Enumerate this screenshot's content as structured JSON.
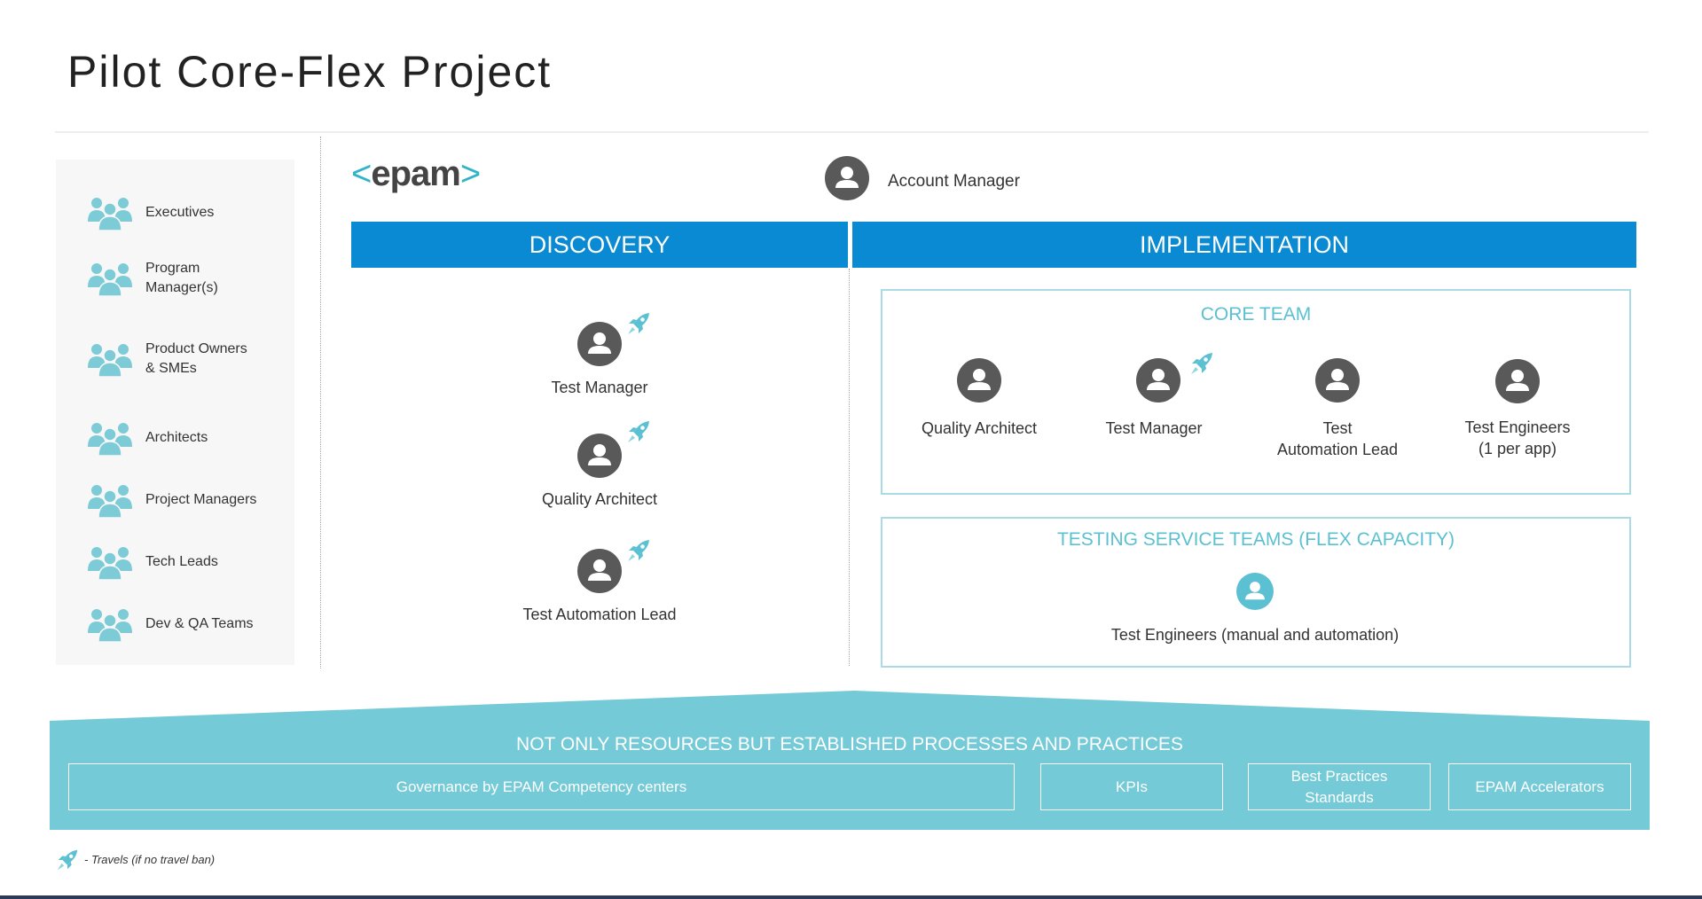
{
  "title": "Pilot Core-Flex Project",
  "colors": {
    "accent_blue": "#0a8ad2",
    "teal": "#5bc0d2",
    "band_teal": "#74cad6",
    "avatar_grey": "#595959"
  },
  "stakeholders": [
    {
      "label": "Executives",
      "icon": "people-group-icon"
    },
    {
      "label": "Program\nManager(s)",
      "icon": "people-group-icon"
    },
    {
      "label": "Product Owners\n& SMEs",
      "icon": "people-group-icon"
    },
    {
      "label": "Architects",
      "icon": "people-group-icon"
    },
    {
      "label": "Project Managers",
      "icon": "people-group-icon"
    },
    {
      "label": "Tech Leads",
      "icon": "people-group-icon"
    },
    {
      "label": "Dev & QA Teams",
      "icon": "people-group-icon"
    }
  ],
  "logo": {
    "left_bracket": "<",
    "text": "epam",
    "right_bracket": ">"
  },
  "account_manager": "Account Manager",
  "phases": {
    "discovery": "DISCOVERY",
    "implementation": "IMPLEMENTATION"
  },
  "discovery_roles": [
    "Test Manager",
    "Quality Architect",
    "Test Automation Lead"
  ],
  "core_team": {
    "title": "CORE TEAM",
    "roles": [
      "Quality Architect",
      "Test Manager",
      "Test\nAutomation Lead",
      "Test Engineers\n(1 per app)"
    ]
  },
  "flex_team": {
    "title": "TESTING SERVICE TEAMS (FLEX CAPACITY)",
    "role": "Test Engineers (manual and automation)"
  },
  "foundation": {
    "title": "NOT ONLY RESOURCES BUT ESTABLISHED PROCESSES AND PRACTICES",
    "items": [
      "Governance by EPAM Competency centers",
      "KPIs",
      "Best Practices\nStandards",
      "EPAM Accelerators"
    ]
  },
  "legend": "- Travels (if no travel ban)"
}
